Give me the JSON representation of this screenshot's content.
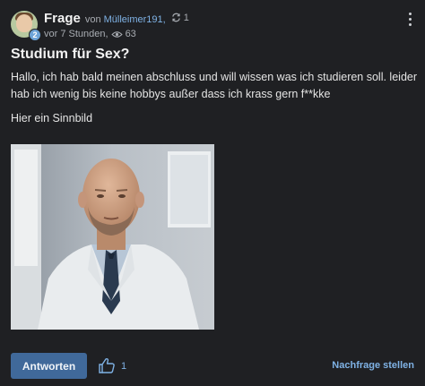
{
  "post": {
    "kind": "Frage",
    "by": "von",
    "author": "Mülleimer191,",
    "answer_count": "1",
    "time": "vor 7 Stunden,",
    "views": "63",
    "level": "2",
    "title": "Studium für Sex?",
    "body_line1": "Hallo, ich hab bald meinen abschluss und will wissen was ich studieren soll. leider hab ich wenig bis keine hobbys außer dass ich krass gern f**kke",
    "body_line2": "Hier ein Sinnbild"
  },
  "actions": {
    "answer_label": "Antworten",
    "like_count": "1",
    "followup_label": "Nachfrage stellen"
  },
  "colors": {
    "accent": "#7fb2e5",
    "button": "#40699a",
    "background": "#1f2023"
  }
}
